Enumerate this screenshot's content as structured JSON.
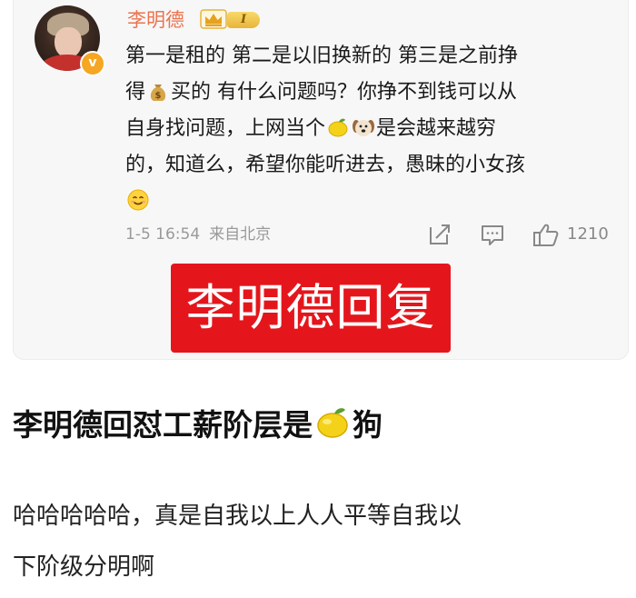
{
  "post": {
    "username": "李明德",
    "level_badge": "I",
    "verified_mark": "v",
    "content_lines": [
      "第一是租的 第二是以旧换新的 第三是之前挣",
      [
        "得",
        "买的 有什么问题吗？你挣不到钱可以从"
      ],
      [
        "自身找问题，上网当个",
        "",
        "是会越来越穷"
      ],
      "的，知道么，希望你能听进去，愚昧的小女孩"
    ],
    "timestamp": "1-5 16:54",
    "source": "来自北京",
    "like_count": "1210",
    "icons": [
      "money-bag-emoji",
      "lemon-emoji",
      "dog-emoji",
      "smile-emoji",
      "share-icon",
      "comment-icon",
      "like-icon",
      "crown-icon",
      "verified-icon"
    ],
    "accent_color": "#eb7350"
  },
  "banner": {
    "text": "李明德回复",
    "color": "#e4161c"
  },
  "headline": {
    "before": "李明德回怼工薪阶层是",
    "after": "狗"
  },
  "body": {
    "lines": [
      "哈哈哈哈哈，真是自我以上人人平等自我以",
      "下阶级分明啊"
    ]
  }
}
